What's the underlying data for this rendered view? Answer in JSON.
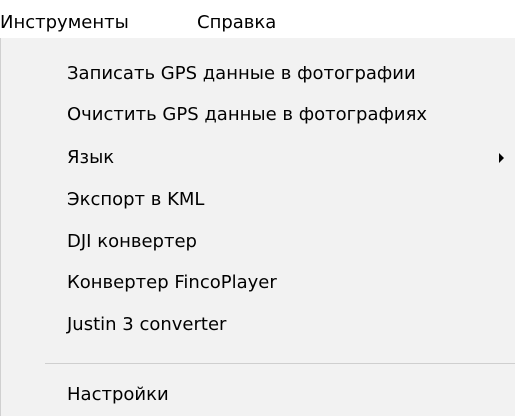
{
  "menubar": {
    "tools": "Инструменты",
    "help": "Справка"
  },
  "tools_menu": {
    "items": [
      {
        "label": "Записать GPS данные в фотографии"
      },
      {
        "label": "Очистить GPS данные в фотографиях"
      },
      {
        "label": "Язык",
        "submenu_icon": "chevron-right-icon"
      },
      {
        "label": "Экспорт в KML"
      },
      {
        "label": "DJI конвертер"
      },
      {
        "label": "Конвертер FincoPlayer"
      },
      {
        "label": "Justin 3 converter"
      },
      {
        "label": "Настройки"
      }
    ]
  },
  "colors": {
    "menu_background": "#f2f2f2",
    "menubar_background": "#ffffff",
    "separator": "#cfcfcf",
    "text": "#000000"
  }
}
